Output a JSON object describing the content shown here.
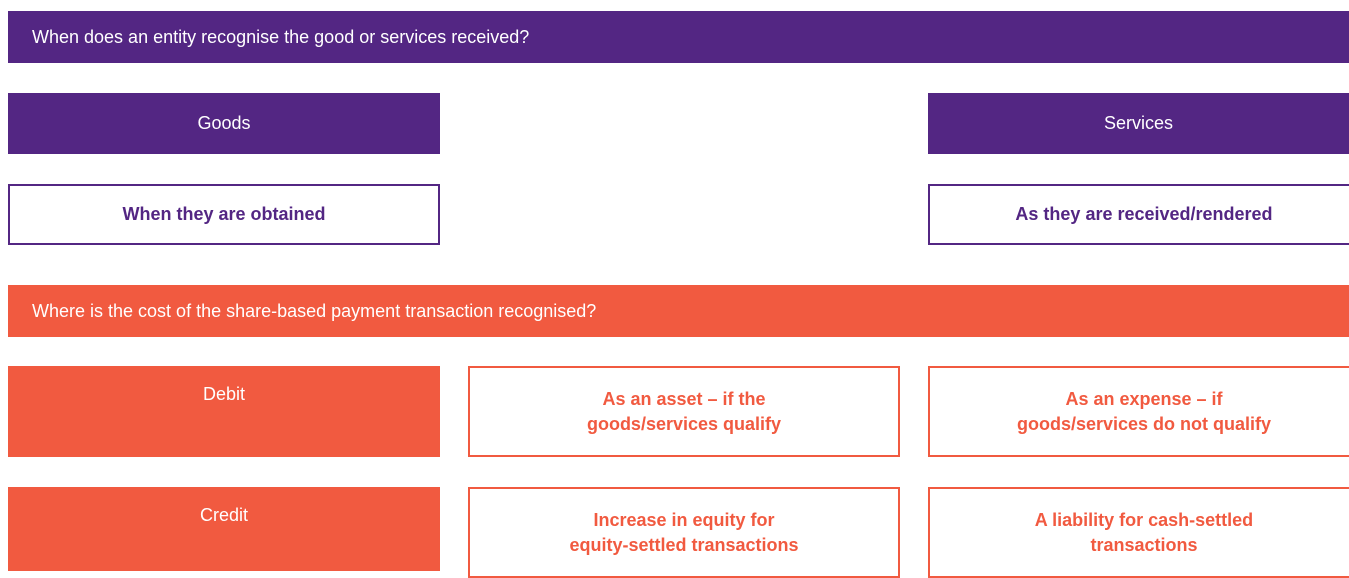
{
  "section1": {
    "title": "When does an entity recognise the good or services received?",
    "goods": {
      "header": "Goods",
      "answer": "When they are obtained"
    },
    "services": {
      "header": "Services",
      "answer": "As they are received/rendered"
    }
  },
  "section2": {
    "title": "Where is the cost of the share-based payment transaction recognised?",
    "debit": {
      "label": "Debit",
      "option1": [
        "As an asset – if the",
        "goods/services qualify"
      ],
      "option2": [
        "As an expense – if",
        "goods/services do not qualify"
      ]
    },
    "credit": {
      "label": "Credit",
      "option1": [
        "Increase in equity for",
        "equity-settled transactions"
      ],
      "option2": [
        "A liability for cash-settled",
        "transactions"
      ]
    }
  },
  "colors": {
    "purple": "#532683",
    "orange": "#f15a40"
  }
}
